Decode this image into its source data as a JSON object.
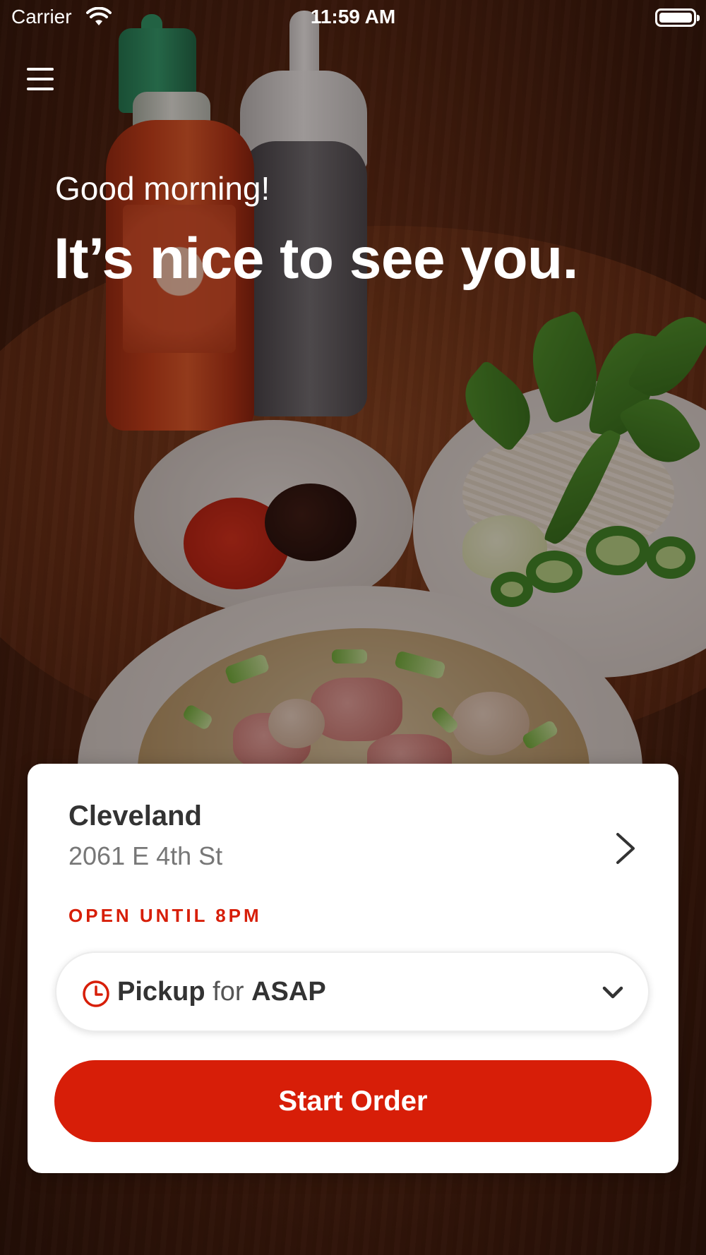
{
  "status_bar": {
    "carrier": "Carrier",
    "time": "11:59 AM",
    "icons": [
      "wifi-icon",
      "battery-icon"
    ]
  },
  "header": {
    "menu_icon": "hamburger-menu-icon"
  },
  "greeting": {
    "salutation": "Good morning!",
    "headline": "It’s nice to see you."
  },
  "location_card": {
    "location_name": "Cleveland",
    "address": "2061 E 4th St",
    "hours": "OPEN UNTIL 8PM",
    "order_mode": {
      "mode": "Pickup",
      "connector": "for",
      "time": "ASAP",
      "icon": "clock-icon"
    },
    "start_button_label": "Start Order"
  },
  "colors": {
    "accent": "#d71e08",
    "card_bg": "#ffffff",
    "text_primary": "#333333",
    "text_secondary": "#777777"
  }
}
